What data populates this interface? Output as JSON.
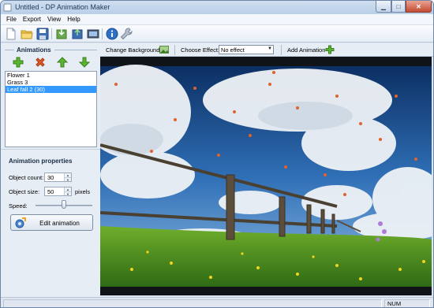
{
  "window": {
    "title": "Untitled - DP Animation Maker"
  },
  "menu": [
    "File",
    "Export",
    "View",
    "Help"
  ],
  "toolbar": {
    "buttons": [
      "new-document",
      "open-folder",
      "save",
      "import",
      "export",
      "render",
      "info",
      "settings"
    ]
  },
  "animations": {
    "title": "Animations",
    "buttons": [
      "add-animation",
      "delete-animation",
      "move-up",
      "move-down"
    ],
    "items": [
      {
        "label": "Flower 1",
        "selected": false
      },
      {
        "label": "Grass 3",
        "selected": false
      },
      {
        "label": "Leaf fall 2 (30)",
        "selected": true
      }
    ]
  },
  "properties": {
    "title": "Animation properties",
    "object_count_label": "Object count:",
    "object_count": "30",
    "object_size_label": "Object size:",
    "object_size": "50",
    "object_size_unit": "pixels",
    "speed_label": "Speed:",
    "speed_level": 0.5,
    "edit_button": "Edit animation"
  },
  "effect_bar": {
    "change_background": "Change Background",
    "choose_effect_label": "Choose Effect:",
    "effect_value": "No effect",
    "add_animation": "Add Animation"
  },
  "status": {
    "num": "NUM"
  },
  "colors": {
    "accent": "#3399ff",
    "chrome": "#dde6f0",
    "sky": "#2e6fb5",
    "grass": "#4f9a1e"
  }
}
